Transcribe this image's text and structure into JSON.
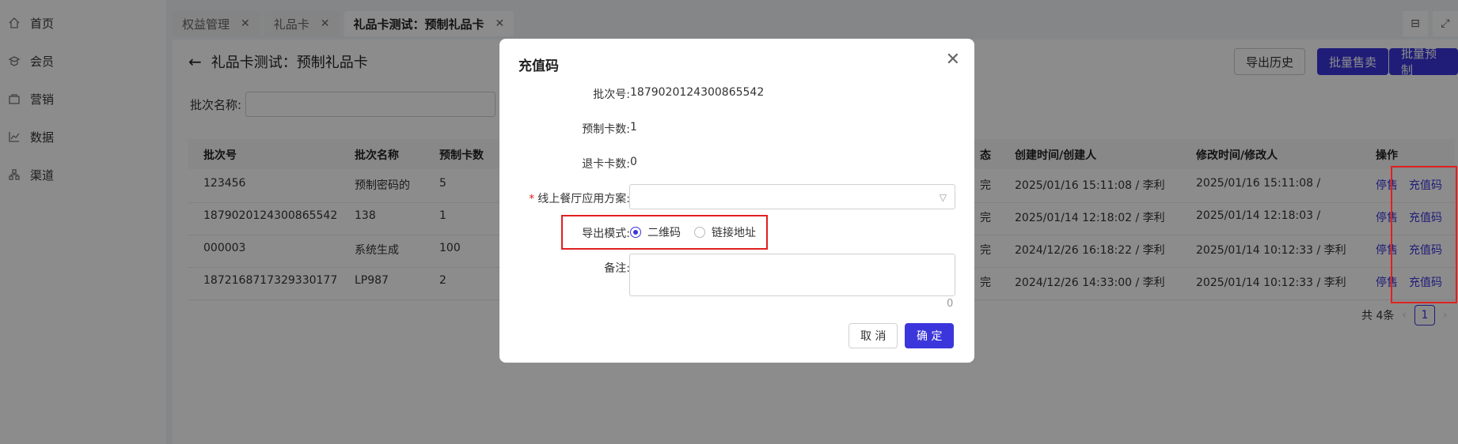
{
  "sidebar": {
    "items": [
      {
        "label": "首页",
        "icon": "home-icon"
      },
      {
        "label": "会员",
        "icon": "member-icon"
      },
      {
        "label": "营销",
        "icon": "marketing-icon"
      },
      {
        "label": "数据",
        "icon": "chart-icon"
      },
      {
        "label": "渠道",
        "icon": "channel-icon"
      }
    ]
  },
  "tabs": [
    {
      "label": "权益管理"
    },
    {
      "label": "礼品卡"
    },
    {
      "label": "礼品卡测试：预制礼品卡"
    }
  ],
  "page": {
    "title": "礼品卡测试：预制礼品卡",
    "buttons": {
      "export_history": "导出历史",
      "batch_sell": "批量售卖",
      "batch_prefab": "批量预制"
    },
    "filter_label": "批次名称:"
  },
  "table": {
    "headers": {
      "batch_no": "批次号",
      "batch_name": "批次名称",
      "prefab_count": "预制卡数",
      "status_fragment": "态",
      "created": "创建时间/创建人",
      "modified": "修改时间/修改人",
      "actions": "操作"
    },
    "rows": [
      {
        "batch_no": "123456",
        "batch_name": "预制密码的",
        "prefab_count": "5",
        "status_fragment": "完",
        "created": "2025/01/16 15:11:08 / 李利",
        "modified": "2025/01/16 15:11:08 /",
        "stop": "停售",
        "recharge": "充值码"
      },
      {
        "batch_no": "1879020124300865542",
        "batch_name": "138",
        "prefab_count": "1",
        "status_fragment": "完",
        "created": "2025/01/14 12:18:02 / 李利",
        "modified": "2025/01/14 12:18:03 /",
        "stop": "停售",
        "recharge": "充值码"
      },
      {
        "batch_no": "000003",
        "batch_name": "系统生成",
        "prefab_count": "100",
        "status_fragment": "完",
        "created": "2024/12/26 16:18:22 / 李利",
        "modified": "2025/01/14 10:12:33 / 李利",
        "stop": "停售",
        "recharge": "充值码"
      },
      {
        "batch_no": "1872168717329330177",
        "batch_name": "LP987",
        "prefab_count": "2",
        "status_fragment": "完",
        "created": "2024/12/26 14:33:00 / 李利",
        "modified": "2025/01/14 10:12:33 / 李利",
        "stop": "停售",
        "recharge": "充值码"
      }
    ]
  },
  "pagination": {
    "total": "共 4条",
    "current": "1"
  },
  "modal": {
    "title": "充值码",
    "fields": {
      "batch_no_label": "批次号:",
      "batch_no_value": "1879020124300865542",
      "prefab_label": "预制卡数:",
      "prefab_value": "1",
      "refund_label": "退卡卡数:",
      "refund_value": "0",
      "scheme_label": "线上餐厅应用方案:",
      "scheme_value": "",
      "export_label": "导出模式:",
      "export_options": [
        "二维码",
        "链接地址"
      ],
      "export_selected": "二维码",
      "remark_label": "备注:",
      "remark_value": "",
      "remark_count": "0"
    },
    "buttons": {
      "cancel": "取 消",
      "ok": "确 定"
    }
  },
  "colors": {
    "primary": "#3b36db",
    "highlight": "#e02020"
  }
}
